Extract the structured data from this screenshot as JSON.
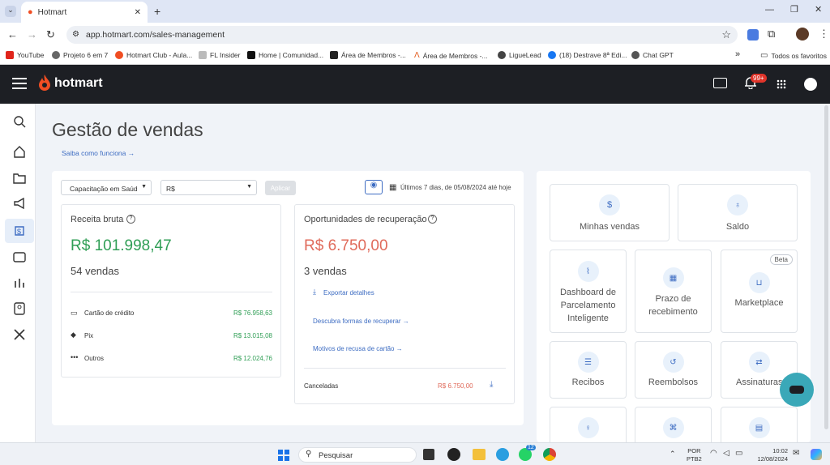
{
  "browser": {
    "tab_title": "Hotmart",
    "url": "app.hotmart.com/sales-management",
    "bookmarks": [
      "YouTube",
      "Projeto 6 em 7",
      "Hotmart Club - Aula...",
      "FL Insider",
      "Home | Comunidad...",
      "Área de Membros -...",
      "Área de Membros -...",
      "LigueLead",
      "(18) Destrave 8ª Edi...",
      "Chat GPT"
    ],
    "bookmarks_more": "»",
    "all_favorites": "Todos os favoritos"
  },
  "header": {
    "logo": "hotmart",
    "notif_badge": "99+"
  },
  "page": {
    "title": "Gestão de vendas",
    "help_link": "Saiba como funciona →"
  },
  "filters": {
    "product": "Capacitação em Saúd",
    "currency": "R$",
    "apply": "Aplicar",
    "date_range": "Últimos 7 dias, de 05/08/2024 até hoje"
  },
  "revenue": {
    "title": "Receita bruta",
    "amount": "R$ 101.998,47",
    "sales": "54 vendas",
    "rows": [
      {
        "label": "Cartão de crédito",
        "value": "R$ 76.958,63"
      },
      {
        "label": "Pix",
        "value": "R$ 13.015,08"
      },
      {
        "label": "Outros",
        "value": "R$ 12.024,76"
      }
    ]
  },
  "recovery": {
    "title": "Oportunidades de recuperação",
    "amount": "R$ 6.750,00",
    "sales": "3 vendas",
    "export": "Exportar detalhes",
    "link1": "Descubra formas de recuperar →",
    "link2": "Motivos de recusa de cartão →",
    "cancel_label": "Canceladas",
    "cancel_value": "R$ 6.750,00"
  },
  "tiles": {
    "minhas_vendas": "Minhas vendas",
    "saldo": "Saldo",
    "dashboard": "Dashboard de Parcelamento Inteligente",
    "prazo": "Prazo de recebimento",
    "marketplace": "Marketplace",
    "beta": "Beta",
    "recibos": "Recibos",
    "reembolsos": "Reembolsos",
    "assinaturas": "Assinaturas"
  },
  "taskbar": {
    "search": "Pesquisar",
    "lang1": "POR",
    "lang2": "PTB2",
    "time": "10:02",
    "date": "12/08/2024",
    "whatsapp_badge": "12"
  },
  "colors": {
    "accent": "#3d6cc2",
    "green": "#2f9e55",
    "red": "#e06a5a",
    "brand": "#f04e23",
    "header_bg": "#1d1f24"
  }
}
